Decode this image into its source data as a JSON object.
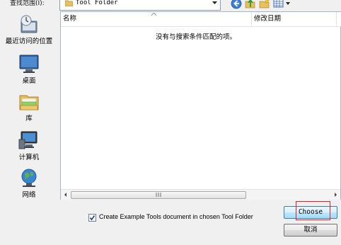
{
  "toolbar": {
    "look_in_label": "查找范围(I):",
    "path_value": "Tool Folder"
  },
  "places": [
    {
      "label": "最近访问的位置",
      "icon": "recent-places-icon"
    },
    {
      "label": "桌面",
      "icon": "desktop-icon"
    },
    {
      "label": "库",
      "icon": "libraries-icon"
    },
    {
      "label": "计算机",
      "icon": "computer-icon"
    },
    {
      "label": "网络",
      "icon": "network-icon"
    }
  ],
  "file_list": {
    "columns": [
      "名称",
      "修改日期"
    ],
    "empty_message": "没有与搜索条件匹配的项。"
  },
  "options": {
    "example_checkbox_label": "Create Example Tools document in chosen Tool Folder",
    "example_checked": true
  },
  "buttons": {
    "choose": "Choose",
    "cancel": "取消"
  }
}
